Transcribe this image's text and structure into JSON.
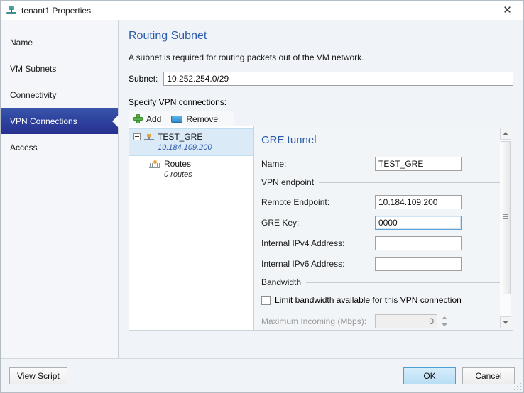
{
  "window": {
    "title": "tenant1 Properties",
    "icon": "network-service-icon",
    "close_label": "✕"
  },
  "sidebar": {
    "items": [
      {
        "label": "Name",
        "selected": false
      },
      {
        "label": "VM Subnets",
        "selected": false
      },
      {
        "label": "Connectivity",
        "selected": false
      },
      {
        "label": "VPN Connections",
        "selected": true
      },
      {
        "label": "Access",
        "selected": false
      }
    ]
  },
  "main": {
    "page_title": "Routing Subnet",
    "description": "A subnet is required for routing packets out of the VM network.",
    "subnet": {
      "label": "Subnet:",
      "value": "10.252.254.0/29",
      "placeholder": ""
    },
    "specify_label": "Specify VPN connections:",
    "toolbar": {
      "add_label": "Add",
      "remove_label": "Remove"
    },
    "tree": {
      "root": {
        "title": "TEST_GRE",
        "subtitle": "10.184.109.200",
        "selected": true,
        "expanded": true
      },
      "child": {
        "title": "Routes",
        "subtitle": "0 routes"
      }
    },
    "detail": {
      "title": "GRE tunnel",
      "name_label": "Name:",
      "name_value": "TEST_GRE",
      "section_endpoint": "VPN endpoint",
      "remote_endpoint_label": "Remote Endpoint:",
      "remote_endpoint_value": "10.184.109.200",
      "gre_key_label": "GRE Key:",
      "gre_key_value": "0000",
      "ipv4_label": "Internal IPv4 Address:",
      "ipv4_value": "",
      "ipv6_label": "Internal IPv6 Address:",
      "ipv6_value": "",
      "section_bandwidth": "Bandwidth",
      "limit_checkbox_label": "Limit bandwidth available for this VPN connection",
      "limit_checked": false,
      "max_incoming_label": "Maximum Incoming (Mbps):",
      "max_incoming_value": "0"
    }
  },
  "footer": {
    "view_script_label": "View Script",
    "ok_label": "OK",
    "cancel_label": "Cancel"
  },
  "colors": {
    "accent_blue": "#2a5caa",
    "selected_nav": "#2f46a0",
    "tree_selection": "#dbeaf7",
    "add_icon_green": "#59b349",
    "remove_icon_blue": "#2f8ccd",
    "default_button_blue": "#b9def5"
  }
}
